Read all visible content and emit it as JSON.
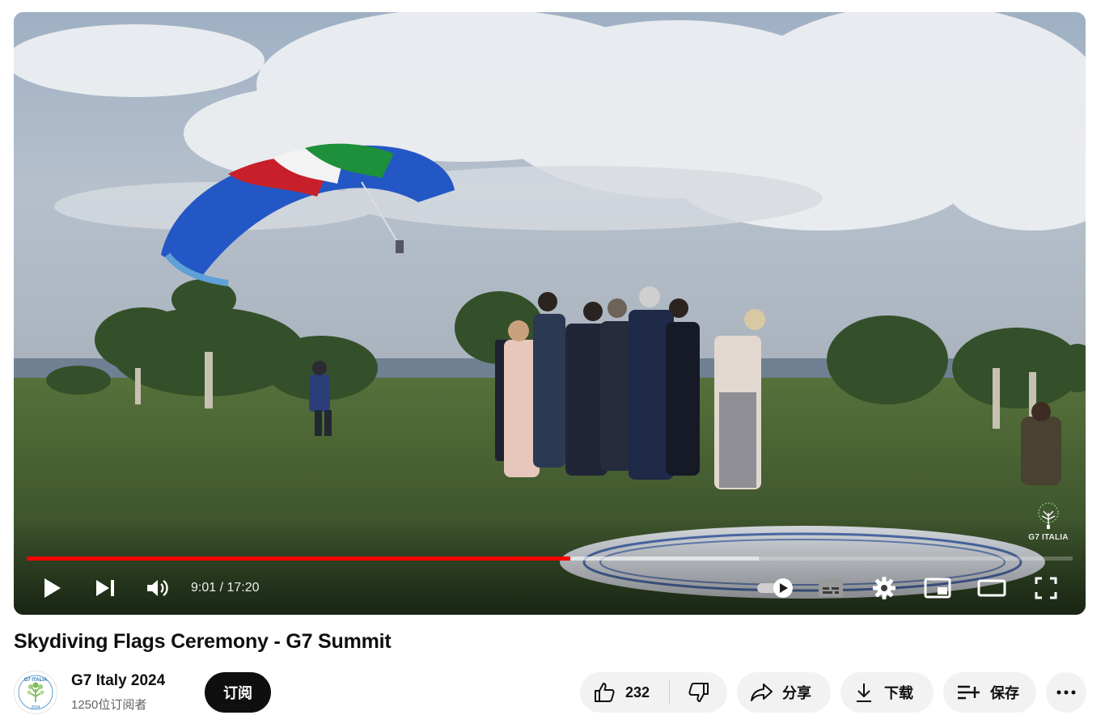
{
  "player": {
    "time_current": "9:01",
    "time_separator": "/",
    "time_total": "17:20",
    "progress_played": 0.52,
    "progress_buffered": 0.7,
    "watermark_text": "G7 ITALIA",
    "autoplay_on": true
  },
  "video": {
    "title": "Skydiving Flags Ceremony - G7 Summit"
  },
  "channel": {
    "name": "G7 Italy 2024",
    "subscribers": "1250位订阅者",
    "avatar_text": "G7 ITALIA",
    "avatar_year": "2024"
  },
  "actions": {
    "subscribe_label": "订阅",
    "like_count": "232",
    "share_label": "分享",
    "download_label": "下载",
    "save_label": "保存"
  },
  "icons": {
    "play": "play-icon",
    "next": "next-icon",
    "volume": "volume-icon",
    "autoplay": "autoplay-toggle-icon",
    "captions": "captions-icon",
    "settings": "gear-icon",
    "miniplayer": "miniplayer-icon",
    "theater": "theater-icon",
    "fullscreen": "fullscreen-icon",
    "like": "thumbs-up-icon",
    "dislike": "thumbs-down-icon",
    "share": "share-icon",
    "download": "download-icon",
    "save": "save-playlist-icon",
    "more": "more-icon"
  },
  "colors": {
    "progress_played": "#ff0000",
    "subscribe_bg": "#0f0f0f",
    "pill_bg": "#f2f2f2"
  }
}
